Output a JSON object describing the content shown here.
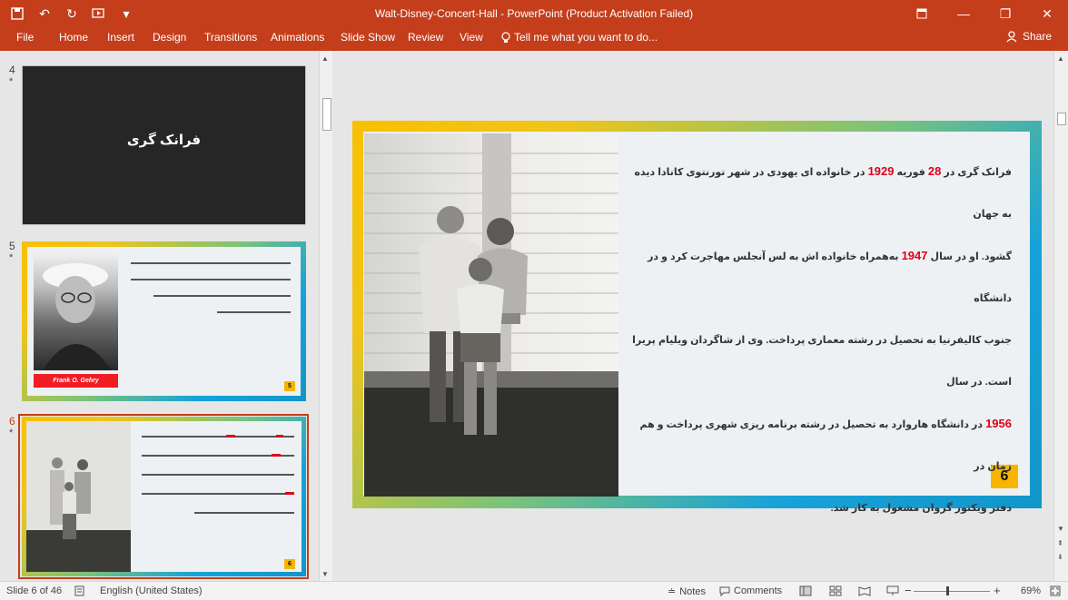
{
  "window": {
    "title": "Walt-Disney-Concert-Hall - PowerPoint (Product Activation Failed)",
    "controls": [
      "restore-icon",
      "minimize-icon",
      "maximize-icon",
      "close-icon"
    ]
  },
  "qat": {
    "icons": [
      "save-icon",
      "undo-icon",
      "redo-icon",
      "start-from-beginning-icon",
      "customize-qat-icon"
    ]
  },
  "ribbon": {
    "tabs": [
      "File",
      "Home",
      "Insert",
      "Design",
      "Transitions",
      "Animations",
      "Slide Show",
      "Review",
      "View"
    ],
    "tell_me": "Tell me what you want to do...",
    "share": "Share"
  },
  "thumbnails": [
    {
      "number": "4",
      "star": "*",
      "title": "فرانک گری"
    },
    {
      "number": "5",
      "star": "*",
      "caption": "Frank O. Gehry",
      "badge": "5"
    },
    {
      "number": "6",
      "star": "*",
      "badge": "6"
    }
  ],
  "slide": {
    "badge": "6",
    "text": {
      "l1a": "فرانک گری در ",
      "l1b": "28",
      "l1c": " فوریه ",
      "l1d": "1929",
      "l1e": " در خانواده ای یهودی در شهر تورنتوی کانادا دیده به جهان",
      "l2a": "گشود. او در سال ",
      "l2b": "1947",
      "l2c": " به‌همراه خانواده اش به لس آنجلس مهاجرت کرد و در دانشگاه",
      "l3": "جنوب کالیفرنیا به تحصیل در رشته معماری پرداخت. وی از شاگردان ویلیام پریرا است. در سال",
      "l4a": "1956",
      "l4b": " در دانشگاه هاروارد به تحصیل در رشته برنامه ریزی شهری پرداخت و هم زمان در",
      "l5": "دفتر ویکتور گروان مشغول به کار شد."
    }
  },
  "status": {
    "slide_info": "Slide 6 of 46",
    "language": "English (United States)",
    "notes": "Notes",
    "comments": "Comments",
    "zoom": "69%"
  },
  "colors": {
    "accent": "#c43e1c",
    "highlight_red": "#e0001a",
    "badge_yellow": "#f7b500",
    "frame_blue": "#17a2d9"
  }
}
